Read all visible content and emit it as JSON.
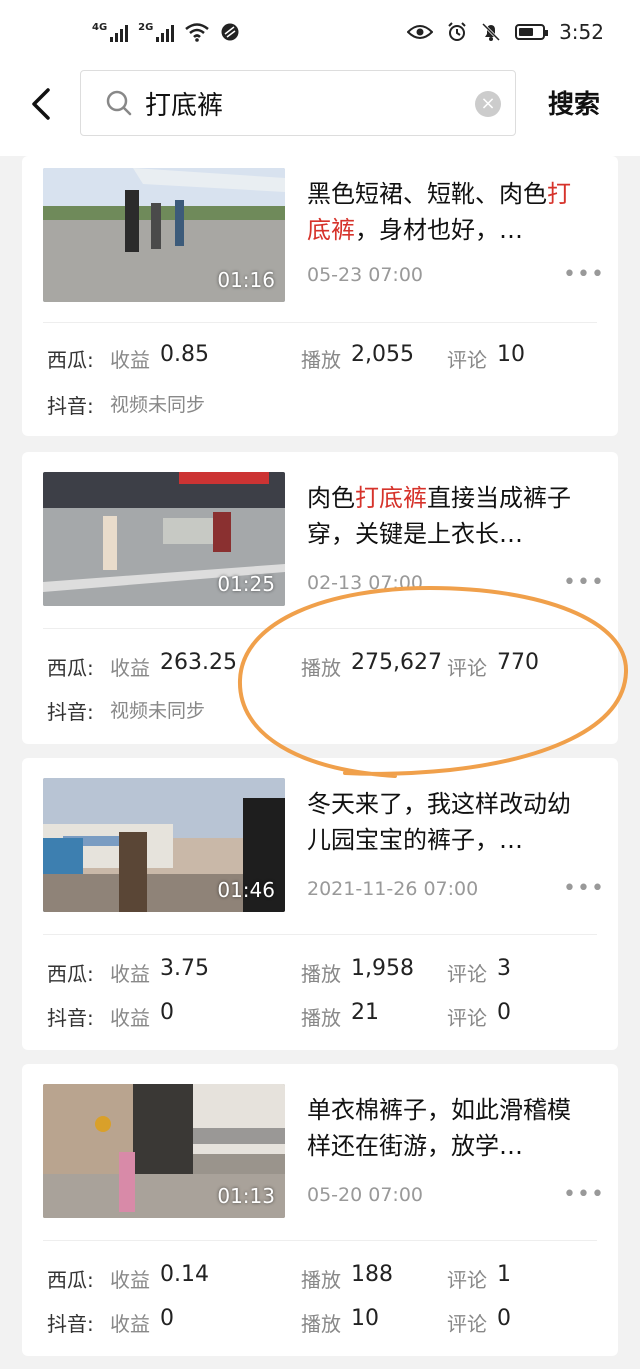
{
  "status_bar": {
    "time": "3:52",
    "net1": "4G",
    "net2": "2G",
    "battery_level": 0.6
  },
  "search": {
    "query": "打底裤",
    "button_label": "搜索"
  },
  "results": [
    {
      "title_pre": "黑色短裙、短靴、肉色",
      "title_hl": "打底裤",
      "title_post": "，身材也好，…",
      "duration": "01:16",
      "date": "05-23 07:00",
      "more": "•••",
      "xigua": {
        "platform": "西瓜:",
        "revenue_label": "收益",
        "revenue": "0.85",
        "plays_label": "播放",
        "plays": "2,055",
        "comments_label": "评论",
        "comments": "10"
      },
      "douyin": {
        "platform": "抖音:",
        "sync_text": "视频未同步"
      }
    },
    {
      "title_pre": "肉色",
      "title_hl": "打底裤",
      "title_post": "直接当成裤子穿，关键是上衣长…",
      "duration": "01:25",
      "date": "02-13 07:00",
      "more": "•••",
      "xigua": {
        "platform": "西瓜:",
        "revenue_label": "收益",
        "revenue": "263.25",
        "plays_label": "播放",
        "plays": "275,627",
        "comments_label": "评论",
        "comments": "770"
      },
      "douyin": {
        "platform": "抖音:",
        "sync_text": "视频未同步"
      }
    },
    {
      "title_pre": "冬天来了，我这样改动幼儿园宝宝的裤子，…",
      "title_hl": "",
      "title_post": "",
      "duration": "01:46",
      "date": "2021-11-26 07:00",
      "more": "•••",
      "xigua": {
        "platform": "西瓜:",
        "revenue_label": "收益",
        "revenue": "3.75",
        "plays_label": "播放",
        "plays": "1,958",
        "comments_label": "评论",
        "comments": "3"
      },
      "douyin": {
        "platform": "抖音:",
        "revenue_label": "收益",
        "revenue": "0",
        "plays_label": "播放",
        "plays": "21",
        "comments_label": "评论",
        "comments": "0"
      }
    },
    {
      "title_pre": "单衣棉裤子，如此滑稽模样还在街游，放学…",
      "title_hl": "",
      "title_post": "",
      "duration": "01:13",
      "date": "05-20 07:00",
      "more": "•••",
      "xigua": {
        "platform": "西瓜:",
        "revenue_label": "收益",
        "revenue": "0.14",
        "plays_label": "播放",
        "plays": "188",
        "comments_label": "评论",
        "comments": "1"
      },
      "douyin": {
        "platform": "抖音:",
        "revenue_label": "收益",
        "revenue": "0",
        "plays_label": "播放",
        "plays": "10",
        "comments_label": "评论",
        "comments": "0"
      }
    }
  ],
  "colors": {
    "highlight": "#d6332b",
    "annotation": "#f0a04b"
  }
}
